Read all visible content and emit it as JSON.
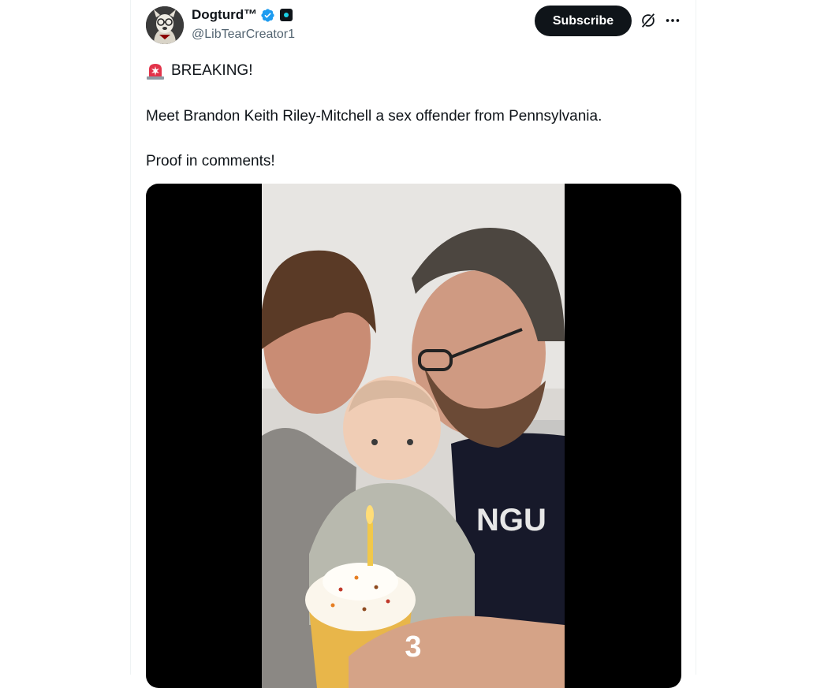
{
  "author": {
    "display_name": "Dogturd™",
    "handle": "@LibTearCreator1"
  },
  "actions": {
    "subscribe_label": "Subscribe"
  },
  "tweet": {
    "lines": [
      "BREAKING!",
      "Meet Brandon Keith Riley-Mitchell a sex offender from Pennsylvania.",
      "Proof in comments!"
    ]
  },
  "media": {
    "overlay_countdown": "3"
  },
  "colors": {
    "accent": "#1d9bf0",
    "text_primary": "#0f1419",
    "text_secondary": "#536471",
    "button_dark": "#0f1419"
  },
  "icons": [
    "verified-badge-icon",
    "affiliate-badge-icon",
    "grok-icon",
    "more-options-icon",
    "siren-icon"
  ]
}
